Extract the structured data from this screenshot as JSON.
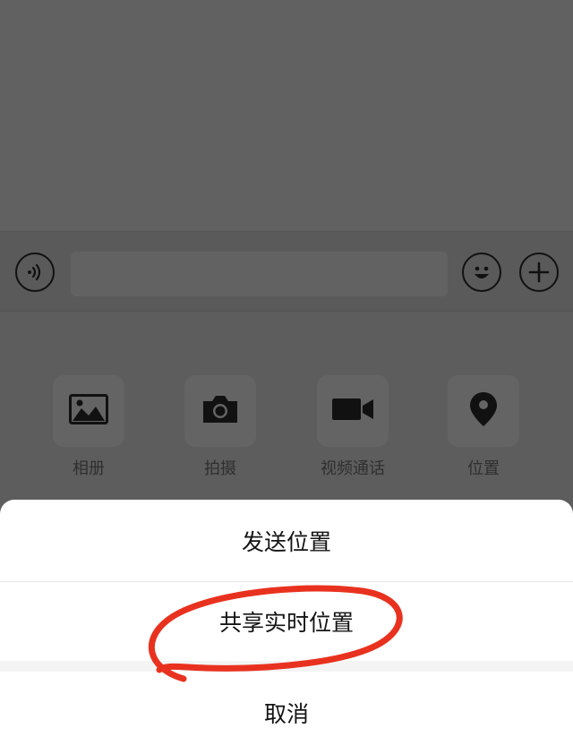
{
  "input_bar": {
    "voice_icon": "voice-wave-icon",
    "text_value": "",
    "emoji_icon": "smiley-face-icon",
    "plus_icon": "plus-icon"
  },
  "tools": [
    {
      "label": "相册",
      "icon": "photo-album-icon"
    },
    {
      "label": "拍摄",
      "icon": "camera-icon"
    },
    {
      "label": "视频通话",
      "icon": "video-camera-icon"
    },
    {
      "label": "位置",
      "icon": "location-pin-icon"
    }
  ],
  "action_sheet": {
    "send_location": "发送位置",
    "share_live_location": "共享实时位置",
    "cancel": "取消"
  },
  "colors": {
    "overlay": "#5e5e5e",
    "sheet_bg": "#ffffff",
    "annotation_stroke": "#e8321f"
  }
}
